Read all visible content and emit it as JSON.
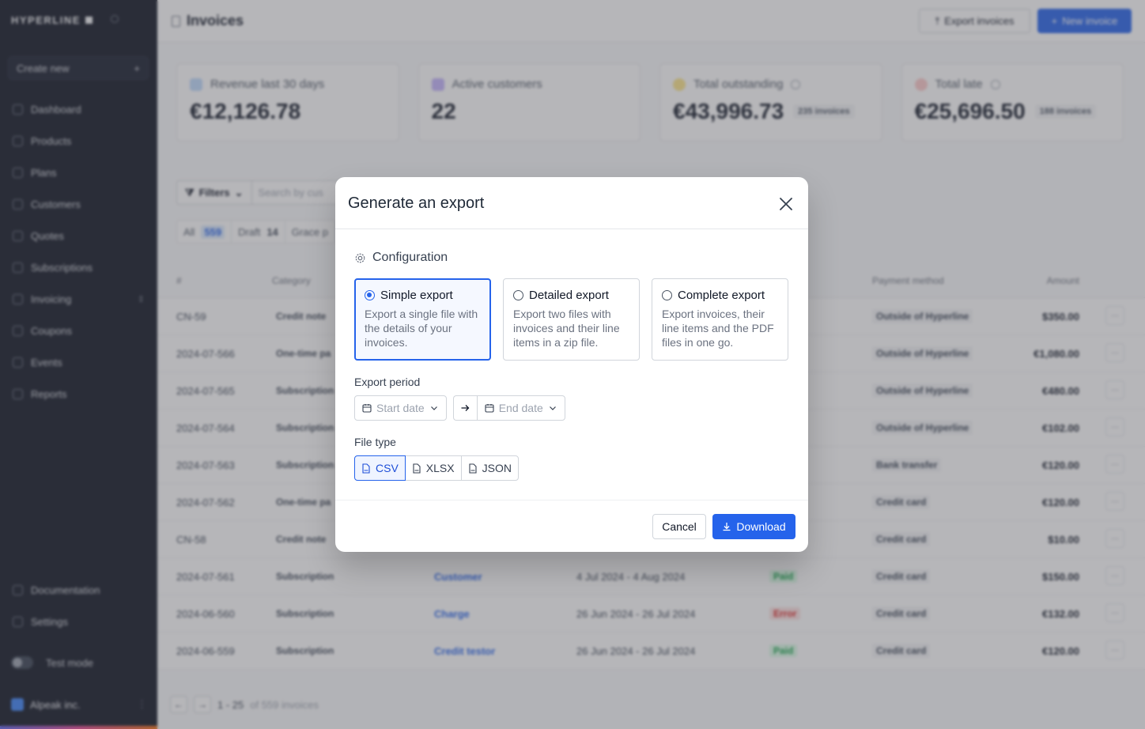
{
  "app": {
    "logo": "HYPERLINE"
  },
  "sidebar": {
    "create_new": "Create new",
    "items": [
      {
        "label": "Dashboard",
        "icon": "chart-icon"
      },
      {
        "label": "Products",
        "icon": "box-icon"
      },
      {
        "label": "Plans",
        "icon": "plans-icon"
      },
      {
        "label": "Customers",
        "icon": "users-icon"
      },
      {
        "label": "Quotes",
        "icon": "quote-icon"
      },
      {
        "label": "Subscriptions",
        "icon": "refresh-icon"
      },
      {
        "label": "Invoicing",
        "icon": "invoice-icon"
      },
      {
        "label": "Coupons",
        "icon": "tag-icon"
      },
      {
        "label": "Events",
        "icon": "events-icon"
      },
      {
        "label": "Reports",
        "icon": "reports-icon"
      }
    ],
    "bottom_items": [
      {
        "label": "Documentation",
        "icon": "book-icon"
      },
      {
        "label": "Settings",
        "icon": "gear-icon"
      }
    ],
    "test_mode": "Test mode",
    "company": "Alpeak inc."
  },
  "header": {
    "title": "Invoices",
    "export_button": "Export invoices",
    "new_button": "New invoice"
  },
  "stats": [
    {
      "label": "Revenue last 30 days",
      "value": "€12,126.78",
      "badge": "",
      "icon_color": "#bfdbfe"
    },
    {
      "label": "Active customers",
      "value": "22",
      "badge": "",
      "icon_color": "#c4b5fd"
    },
    {
      "label": "Total outstanding",
      "value": "€43,996.73",
      "badge": "235 invoices",
      "icon_color": "#fde68a"
    },
    {
      "label": "Total late",
      "value": "€25,696.50",
      "badge": "188 invoices",
      "icon_color": "#fecaca"
    }
  ],
  "toolbar": {
    "filters": "Filters",
    "search_placeholder": "Search by cus"
  },
  "status_tabs": [
    {
      "label": "All",
      "count": "559"
    },
    {
      "label": "Draft",
      "count": "14"
    },
    {
      "label": "Grace p",
      "count": ""
    }
  ],
  "table": {
    "headers": {
      "number": "#",
      "category": "Category",
      "payment_method": "Payment method",
      "amount": "Amount"
    },
    "rows": [
      {
        "number": "CN-59",
        "category": "Credit note",
        "customer": "",
        "period": "",
        "status": "",
        "status_type": "",
        "payment": "Outside of Hyperline",
        "amount": "$350.00"
      },
      {
        "number": "2024-07-566",
        "category": "One-time pa",
        "customer": "",
        "period": "",
        "status": "",
        "status_type": "",
        "payment": "Outside of Hyperline",
        "amount": "€1,080.00"
      },
      {
        "number": "2024-07-565",
        "category": "Subscription",
        "customer": "",
        "period": "",
        "status": "",
        "status_type": "",
        "payment": "Outside of Hyperline",
        "amount": "€480.00"
      },
      {
        "number": "2024-07-564",
        "category": "Subscription",
        "customer": "",
        "period": "",
        "status": "",
        "status_type": "",
        "payment": "Outside of Hyperline",
        "amount": "€102.00"
      },
      {
        "number": "2024-07-563",
        "category": "Subscription",
        "customer": "",
        "period": "",
        "status": "",
        "status_type": "",
        "payment": "Bank transfer",
        "amount": "€120.00"
      },
      {
        "number": "2024-07-562",
        "category": "One-time pa",
        "customer": "",
        "period": "",
        "status": "",
        "status_type": "",
        "payment": "Credit card",
        "amount": "€120.00"
      },
      {
        "number": "CN-58",
        "category": "Credit note",
        "customer": "",
        "period": "",
        "status": "",
        "status_type": "",
        "payment": "Credit card",
        "amount": "$10.00"
      },
      {
        "number": "2024-07-561",
        "category": "Subscription",
        "customer": "Customer",
        "period": "4 Jul 2024 - 4 Aug 2024",
        "status": "Paid",
        "status_type": "paid",
        "payment": "Credit card",
        "amount": "$150.00"
      },
      {
        "number": "2024-06-560",
        "category": "Subscription",
        "customer": "Charge",
        "period": "26 Jun 2024 - 26 Jul 2024",
        "status": "Error",
        "status_type": "error",
        "payment": "Credit card",
        "amount": "€132.00"
      },
      {
        "number": "2024-06-559",
        "category": "Subscription",
        "customer": "Credit testor",
        "period": "26 Jun 2024 - 26 Jul 2024",
        "status": "Paid",
        "status_type": "paid",
        "payment": "Credit card",
        "amount": "€120.00"
      }
    ]
  },
  "pager": {
    "range": "1 - 25",
    "of": "of 559 invoices"
  },
  "modal": {
    "title": "Generate an export",
    "section": "Configuration",
    "options": [
      {
        "label": "Simple export",
        "desc": "Export a single file with the details of your invoices.",
        "selected": true
      },
      {
        "label": "Detailed export",
        "desc": "Export two files with invoices and their line items in a zip file.",
        "selected": false
      },
      {
        "label": "Complete export",
        "desc": "Export invoices, their line items and the PDF files in one go.",
        "selected": false
      }
    ],
    "period_label": "Export period",
    "start_placeholder": "Start date",
    "end_placeholder": "End date",
    "filetype_label": "File type",
    "filetypes": [
      "CSV",
      "XLSX",
      "JSON"
    ],
    "cancel": "Cancel",
    "download": "Download",
    "accent": "#2563eb"
  }
}
